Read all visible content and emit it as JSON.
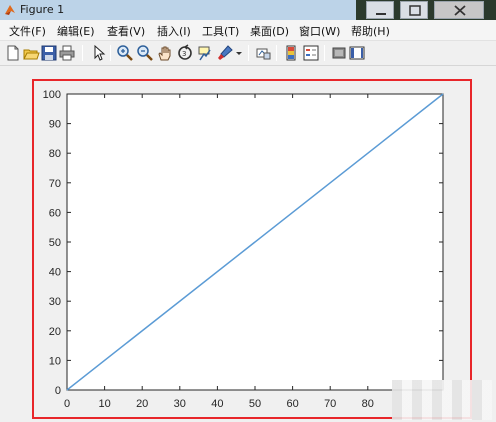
{
  "window": {
    "title": "Figure 1"
  },
  "menu": {
    "items": [
      "文件(F)",
      "编辑(E)",
      "查看(V)",
      "插入(I)",
      "工具(T)",
      "桌面(D)",
      "窗口(W)",
      "帮助(H)"
    ]
  },
  "toolbar": {
    "icons": [
      "new-figure-icon",
      "open-file-icon",
      "save-icon",
      "print-icon",
      "pointer-icon",
      "zoom-in-icon",
      "zoom-out-icon",
      "pan-icon",
      "rotate-3d-icon",
      "data-cursor-icon",
      "brush-icon",
      "dropdown-arrow-icon",
      "link-plot-icon",
      "colorbar-icon",
      "legend-icon",
      "hide-plot-tools-icon",
      "show-plot-tools-icon"
    ]
  },
  "colors": {
    "line": "#5b9bd5",
    "highlight": "#e8262a"
  },
  "chart_data": {
    "type": "line",
    "series": [
      {
        "x": [
          0,
          100
        ],
        "y": [
          0,
          100
        ]
      }
    ],
    "xlim": [
      0,
      100
    ],
    "ylim": [
      0,
      100
    ],
    "xticks": [
      "0",
      "10",
      "20",
      "30",
      "40",
      "50",
      "60",
      "70",
      "80"
    ],
    "yticks": [
      "0",
      "10",
      "20",
      "30",
      "40",
      "50",
      "60",
      "70",
      "80",
      "90",
      "100"
    ],
    "grid": false
  }
}
